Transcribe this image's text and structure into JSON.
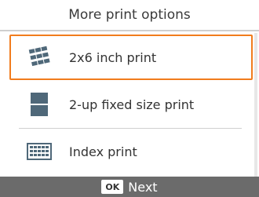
{
  "title": "More print options",
  "options": [
    {
      "label": "2x6 inch print",
      "icon": "multi-tile-print-icon",
      "selected": true
    },
    {
      "label": "2-up fixed size print",
      "icon": "two-up-print-icon",
      "selected": false
    },
    {
      "label": "Index print",
      "icon": "index-grid-icon",
      "selected": false
    }
  ],
  "footer": {
    "ok_label": "OK",
    "next_label": "Next"
  },
  "colors": {
    "selection_border": "#f17c1d",
    "icon_fill": "#4f6879",
    "footer_bg": "#6b6b6b"
  }
}
